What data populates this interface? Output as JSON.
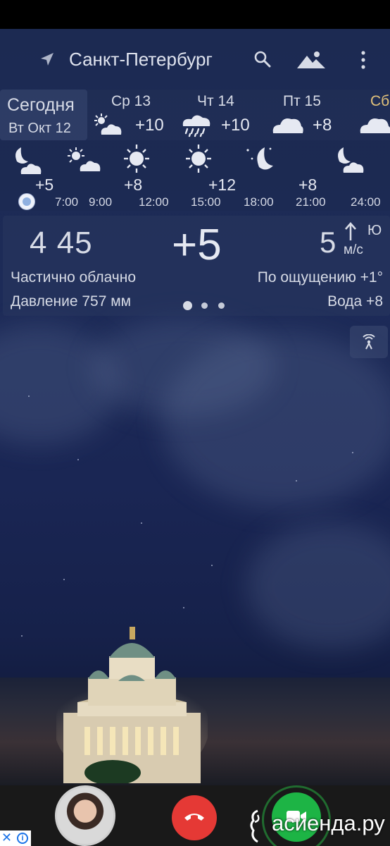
{
  "app": {
    "location": "Санкт-Петербург"
  },
  "days": {
    "today_label": "Сегодня",
    "today_date": "Вт Окт 12",
    "items": [
      {
        "name": "Ср 13",
        "temp": "+10",
        "icon": "partly-cloudy-night-icon"
      },
      {
        "name": "Чт 14",
        "temp": "+10",
        "icon": "rain-icon"
      },
      {
        "name": "Пт 15",
        "temp": "+8",
        "icon": "cloud-icon"
      },
      {
        "name": "Сб",
        "temp": "",
        "icon": "cloud-icon"
      }
    ],
    "weekend_color": "#e2c27a"
  },
  "hourly": {
    "items": [
      {
        "time": "7:00",
        "temp": "+5",
        "icon": "moon-cloud-icon"
      },
      {
        "time": "9:00",
        "temp": "",
        "icon": "sun-cloud-icon"
      },
      {
        "time": "12:00",
        "temp": "+8",
        "icon": "sun-icon"
      },
      {
        "time": "15:00",
        "temp": "+12",
        "icon": "sun-icon"
      },
      {
        "time": "18:00",
        "temp": "",
        "icon": "moon-stars-icon"
      },
      {
        "time": "21:00",
        "temp": "+8",
        "icon": ""
      },
      {
        "time": "24:00",
        "temp": "",
        "icon": "moon-cloud-icon"
      }
    ]
  },
  "current": {
    "time": "4 45",
    "temp": "+5",
    "wind_speed": "5",
    "wind_dir": "Ю",
    "wind_unit": "м/с",
    "description": "Частично облачно",
    "feels_like": "По ощущению +1°",
    "pressure": "Давление 757 мм",
    "water": "Вода +8"
  },
  "ad": {
    "decline_color": "#e53935",
    "accept_color": "#1db445"
  },
  "watermark": {
    "text": "асиенда.ру"
  }
}
